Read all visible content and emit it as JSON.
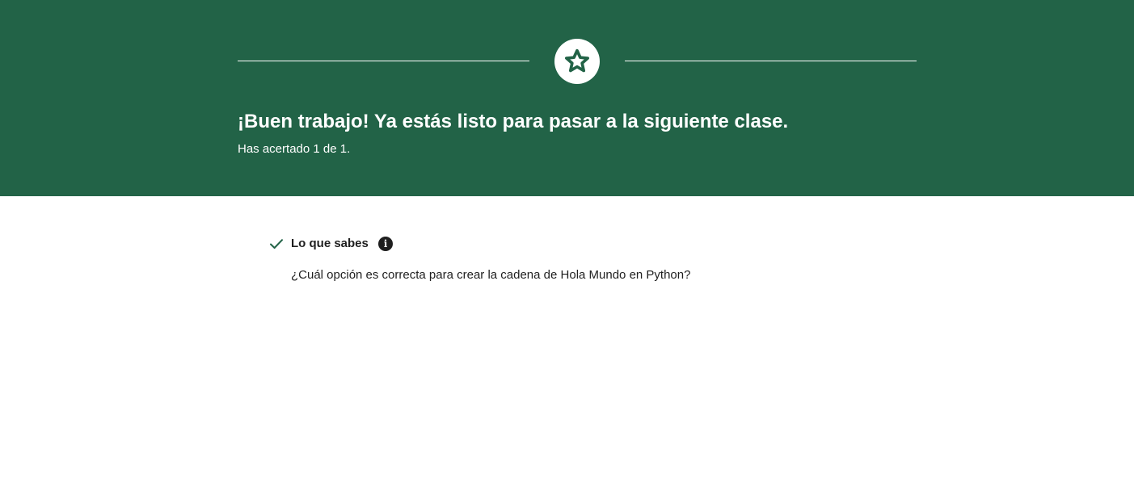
{
  "colors": {
    "banner_bg": "#226347",
    "banner_text": "#ffffff",
    "body_text": "#1f1f1f",
    "check": "#226347"
  },
  "banner": {
    "icon": "star-icon",
    "headline": "¡Buen trabajo! Ya estás listo para pasar a la siguiente clase.",
    "score_text": "Has acertado 1 de 1."
  },
  "result": {
    "status_icon": "check-icon",
    "section_title": "Lo que sabes",
    "info_icon": "info-icon",
    "info_glyph": "i",
    "question": "¿Cuál opción es correcta para crear la cadena de Hola Mundo en Python?"
  }
}
